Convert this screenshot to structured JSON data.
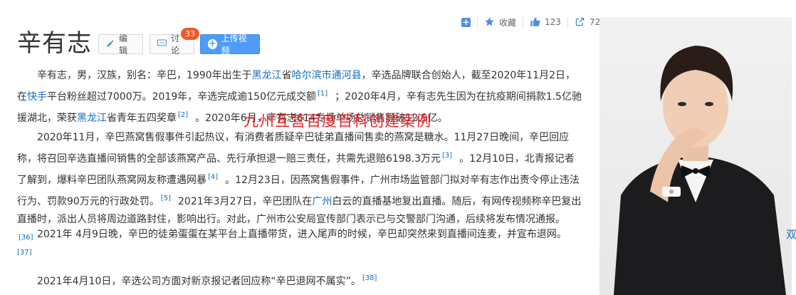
{
  "actions": {
    "favorite_label": "收藏",
    "like_count": "123",
    "share_count": "72"
  },
  "header": {
    "title": "辛有志",
    "edit_label": "编辑",
    "discuss_label": "讨论",
    "discuss_badge": "33",
    "upload_label": "上传视频"
  },
  "watermark": "九州互营百度百科创建案例",
  "paragraphs": {
    "p1": {
      "t1": "辛有志，男，汉族，别名：辛巴，1990年出生于",
      "l1": "黑龙江",
      "t2": "省",
      "l2": "哈尔滨市通河县",
      "t3": "，辛选品牌联合创始人，截至2020年11月2日，在",
      "l3": "快手",
      "t4": "平台粉丝超过7000万。2019年，辛选完成逾150亿元成交额",
      "r1": "[1]",
      "t5": "；2020年4月，辛有志先生因为在抗疫期间捐款1.5亿驰援湖北，荣获",
      "l4": "黑龙江",
      "t6": "省青年五四奖章",
      "r2": "[2]",
      "t7": "。2020年6月，辛有志614专场单场总销售额破12.5亿。"
    },
    "p2": {
      "t1": "2020年11月，辛巴燕窝售假事件引起热议，有消费者质疑辛巴徒弟直播间售卖的燕窝是糖水。11月27日晚间，辛巴回应称，将召回辛选直播间销售的全部该燕窝产品、先行承担退一赔三责任，共需先退赔6198.3万元",
      "r3": "[3]",
      "t2": "。12月10日，北青报记者了解到，爆料辛巴团队燕窝网友称遭遇网暴",
      "r4": "[4]",
      "t3": "。12月23日，因燕窝售假事件，广州市场监管部门拟对辛有志作出责令停止违法行为、罚款90万元的行政处罚。",
      "r5": "[5]",
      "t4": "2021年3月27日，辛巴团队在",
      "l1": "广州",
      "t5": "白云的直播基地复出直播。随后，有网传视频称辛巴复出直播时，派出人员将周边道路封住，影响出行。对此，广州市公安局宣传部门表示已与交警部门沟通，后续将发布情况通报。",
      "r6": "[36]"
    },
    "p3": {
      "t1": "2021年 4月9日晚，辛巴的徒弟蛋蛋在某平台上直播带货，进入尾声的时候，辛巴却突然来到直播间连麦，并宣布退网。",
      "r7": "[37]"
    },
    "p4": {
      "t1": "2021年4月10日，辛选公司方面对新京报记者回应称“辛巴退网不属实”。",
      "r8": "[38]"
    }
  },
  "side_edge_text": "双"
}
